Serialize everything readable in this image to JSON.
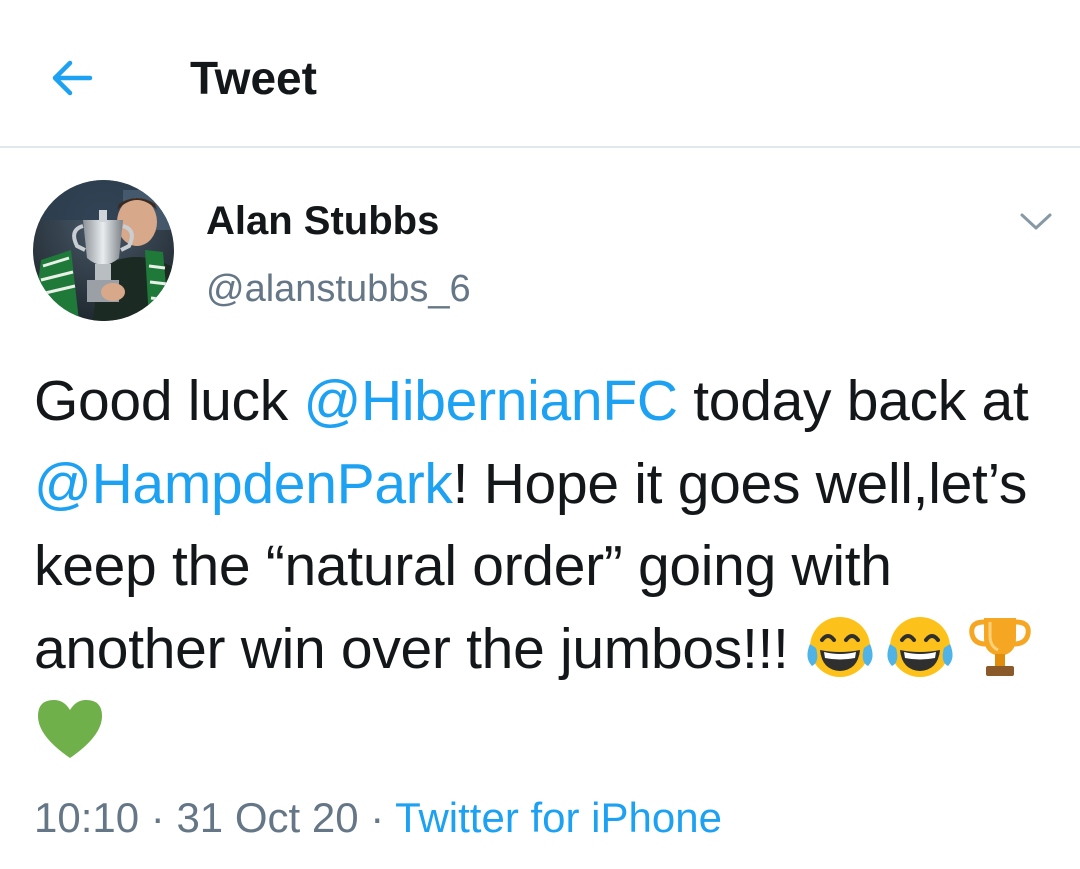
{
  "header": {
    "title": "Tweet",
    "back_icon": "arrow-left-icon"
  },
  "author": {
    "name": "Alan Stubbs",
    "handle": "@alanstubbs_6",
    "avatar_icon": "avatar-photo"
  },
  "tweet": {
    "text_1": "Good luck ",
    "mention_1": "@HibernianFC",
    "text_2": " today back at ",
    "mention_2": "@HampdenPark",
    "text_3": "! Hope it goes well,let’s keep the “natural order” going with another win over the jumbos!!! ",
    "emojis": [
      "face-with-tears-of-joy-icon",
      "face-with-tears-of-joy-icon",
      "trophy-icon",
      "green-heart-icon"
    ]
  },
  "meta": {
    "time": "10:10",
    "separator_1": " · ",
    "date": "31 Oct 20",
    "separator_2": " · ",
    "source": "Twitter for iPhone"
  },
  "colors": {
    "accent": "#1da1f2",
    "secondary_text": "#657786",
    "primary_text": "#14171a",
    "divider": "#e1e8ed"
  }
}
